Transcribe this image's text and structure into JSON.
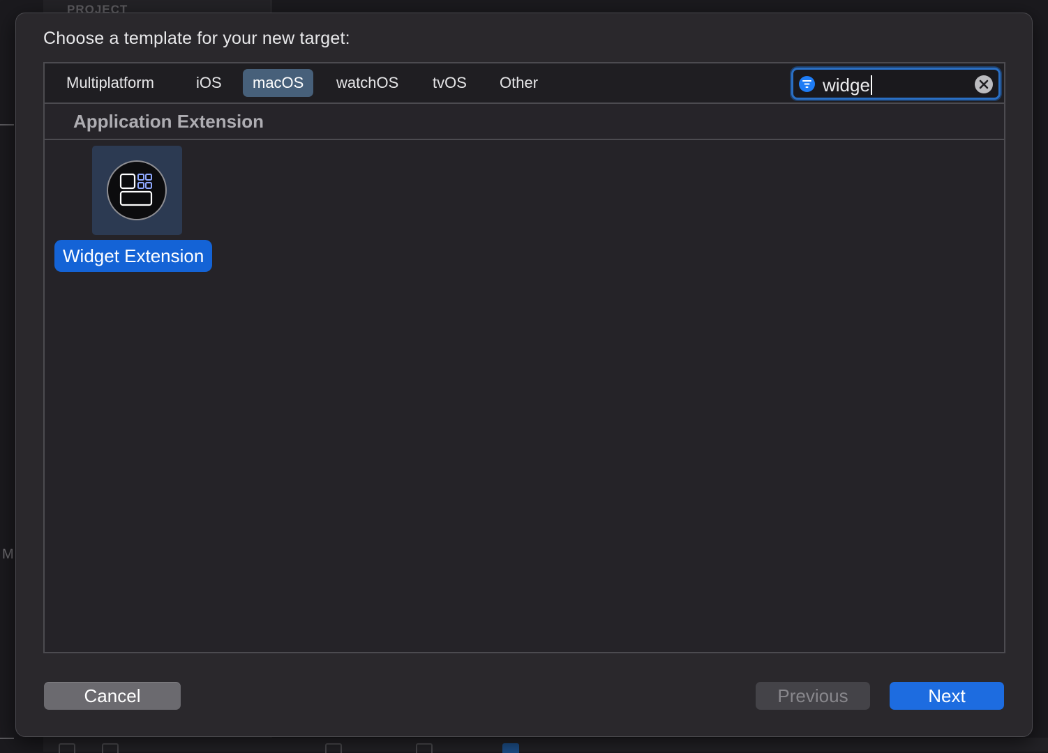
{
  "background": {
    "project_label": "PROJECT",
    "left_letter": "M"
  },
  "dialog": {
    "title": "Choose a template for your new target:",
    "tabs": [
      {
        "label": "Multiplatform",
        "active": false
      },
      {
        "label": "iOS",
        "active": false
      },
      {
        "label": "macOS",
        "active": true
      },
      {
        "label": "watchOS",
        "active": false
      },
      {
        "label": "tvOS",
        "active": false
      },
      {
        "label": "Other",
        "active": false
      }
    ],
    "search": {
      "value": "widge",
      "filter_icon": "filter-icon",
      "clear_icon": "clear-icon"
    },
    "section": {
      "title": "Application Extension"
    },
    "templates": [
      {
        "label": "Widget Extension",
        "icon": "widget-icon",
        "selected": true
      }
    ],
    "buttons": {
      "cancel": "Cancel",
      "previous": "Previous",
      "next": "Next"
    }
  },
  "colors": {
    "accent": "#1d6ce0",
    "selected_tab": "#47607a",
    "selection_label": "#1463d6"
  }
}
